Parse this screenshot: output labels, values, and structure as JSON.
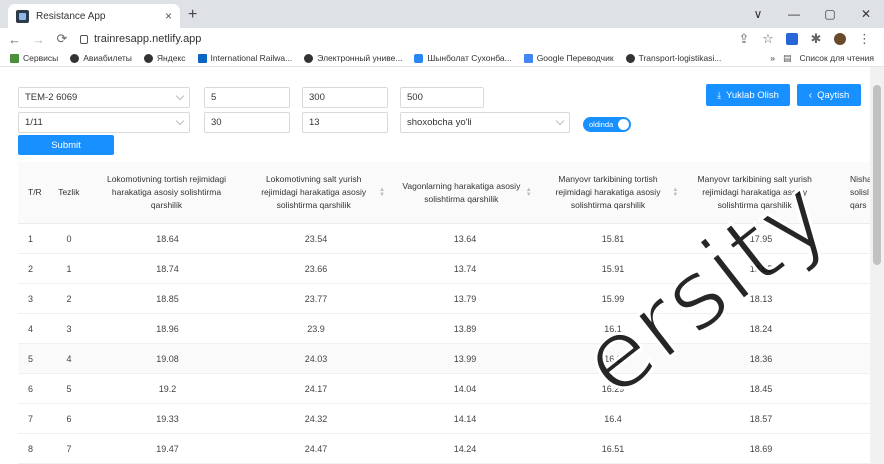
{
  "browser": {
    "tab_title": "Resistance App",
    "tab_close": "×",
    "new_tab": "+",
    "url": "trainresapp.netlify.app",
    "window_controls": [
      "∨",
      "—",
      "▢",
      "✕"
    ],
    "bookmarks": [
      {
        "label": "Сервисы",
        "color": "#4a8f3a"
      },
      {
        "label": "Авиабилеты",
        "color": "#333333"
      },
      {
        "label": "Яндекс",
        "color": "#333333"
      },
      {
        "label": "International Railwa...",
        "color": "#0a66c2"
      },
      {
        "label": "Электронный униве...",
        "color": "#333333"
      },
      {
        "label": "Шынболат Сухонба...",
        "color": "#2787f5"
      },
      {
        "label": "Google Переводчик",
        "color": "#4285f4"
      },
      {
        "label": "Transport-logistikasi...",
        "color": "#333333"
      }
    ],
    "bookmarks_more": "»",
    "reading_list": "Список для чтения"
  },
  "form": {
    "row1": {
      "locomotive": "TEM-2 6069",
      "field2": "5",
      "field3": "300",
      "field4": "500"
    },
    "row2": {
      "ratio": "1/11",
      "field2": "30",
      "field3": "13",
      "track_type": "shoxobcha yo'li"
    },
    "toggle_label": "oldinda",
    "submit_label": "Submit",
    "download_label": "Yuklab Olish",
    "back_label": "Qaytish"
  },
  "table": {
    "headers": [
      "T/R",
      "Tezlik",
      "Lokomotivning tortish rejimidagi harakatiga asosiy solishtirma qarshilik",
      "Lokomotivning salt yurish rejimidagi harakatiga asosiy solishtirma qarshilik",
      "Vagonlarning harakatiga asosiy solishtirma qarshilik",
      "Manyovr tarkibining tortish rejimidagi harakatiga asosiy solishtirma qarshilik",
      "Manyovr tarkibining salt yurish rejimidagi harakatiga asosiy solishtirma qarshilik",
      "Nishal solisl qars"
    ],
    "rows": [
      [
        "1",
        "0",
        "18.64",
        "23.54",
        "13.64",
        "15.81",
        "17.95"
      ],
      [
        "2",
        "1",
        "18.74",
        "23.66",
        "13.74",
        "15.91",
        "18.05"
      ],
      [
        "3",
        "2",
        "18.85",
        "23.77",
        "13.79",
        "15.99",
        "18.13"
      ],
      [
        "4",
        "3",
        "18.96",
        "23.9",
        "13.89",
        "16.1",
        "18.24"
      ],
      [
        "5",
        "4",
        "19.08",
        "24.03",
        "13.99",
        "16.2",
        "18.36"
      ],
      [
        "6",
        "5",
        "19.2",
        "24.17",
        "14.04",
        "16.29",
        "18.45"
      ],
      [
        "7",
        "6",
        "19.33",
        "24.32",
        "14.14",
        "16.4",
        "18.57"
      ],
      [
        "8",
        "7",
        "19.47",
        "24.47",
        "14.24",
        "16.51",
        "18.69"
      ]
    ]
  },
  "watermark": "ersity",
  "colors": {
    "primary": "#1890ff",
    "tabstrip": "#dee1e6"
  }
}
